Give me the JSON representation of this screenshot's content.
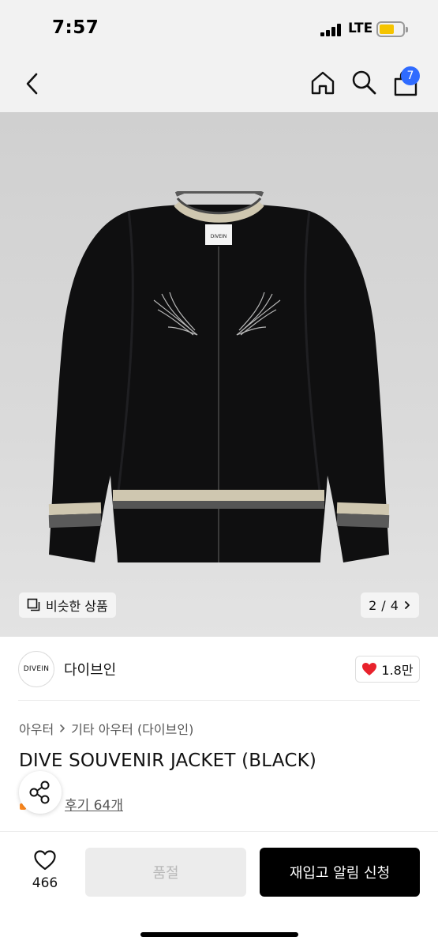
{
  "status_bar": {
    "time": "7:57",
    "network": "LTE",
    "battery_color": "#f5c400"
  },
  "nav": {
    "cart_count": "7",
    "badge_color": "#2f6bff",
    "icons": [
      "back-icon",
      "home-icon",
      "search-icon",
      "cart-icon"
    ]
  },
  "hero": {
    "similar_label": "비슷한 상품",
    "page_current": "2",
    "page_total": "4",
    "page_separator": "/",
    "jacket_label": "DIVEIN"
  },
  "brand": {
    "logo_text": "DIVEIN",
    "name": "다이브인",
    "likes": "1.8만",
    "like_color": "#e8222c"
  },
  "product": {
    "breadcrumb": [
      "아우터",
      "기타 아우터 (다이브인)"
    ],
    "title": "DIVE SOUVENIR JACKET (BLACK)",
    "reviews": "후기 64개"
  },
  "bottom_bar": {
    "wish_count": "466",
    "soldout_label": "품절",
    "restock_label": "재입고 알림 신청"
  }
}
